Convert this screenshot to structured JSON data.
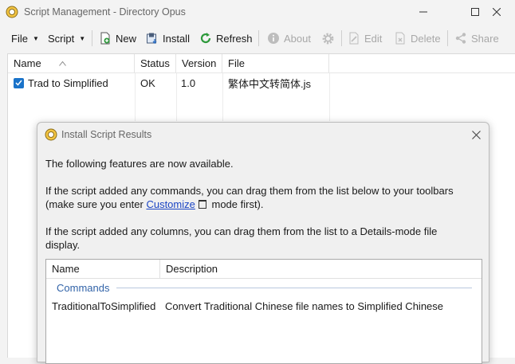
{
  "window": {
    "title": "Script Management - Directory Opus"
  },
  "toolbar": {
    "file": "File",
    "script": "Script",
    "new": "New",
    "install": "Install",
    "refresh": "Refresh",
    "about": "About",
    "edit": "Edit",
    "delete": "Delete",
    "share": "Share"
  },
  "listing": {
    "columns": [
      "Name",
      "Status",
      "Version",
      "File"
    ],
    "rows": [
      {
        "name": "Trad to Simplified",
        "status": "OK",
        "version": "1.0",
        "file": "繁体中文转简体.js",
        "checked": true
      }
    ]
  },
  "dialog": {
    "title": "Install Script Results",
    "line1": "The following features are now available.",
    "line2a": "If the script added any commands, you can drag them from the list below to your toolbars",
    "line2b_pre": "(make sure you enter ",
    "line2b_link": "Customize",
    "line2b_post": " mode first).",
    "line3a": "If the script added any columns, you can drag them from the list to a Details-mode file",
    "line3b": "display.",
    "list": {
      "columns": [
        "Name",
        "Description"
      ],
      "group": "Commands",
      "items": [
        {
          "name": "TraditionalToSimplified",
          "description": "Convert Traditional Chinese file names to Simplified Chinese"
        }
      ]
    }
  },
  "colors": {
    "accent": "#1a73c9",
    "link": "#1b45c4",
    "group_label": "#3163a8",
    "refresh_green": "#2e9a3c"
  }
}
